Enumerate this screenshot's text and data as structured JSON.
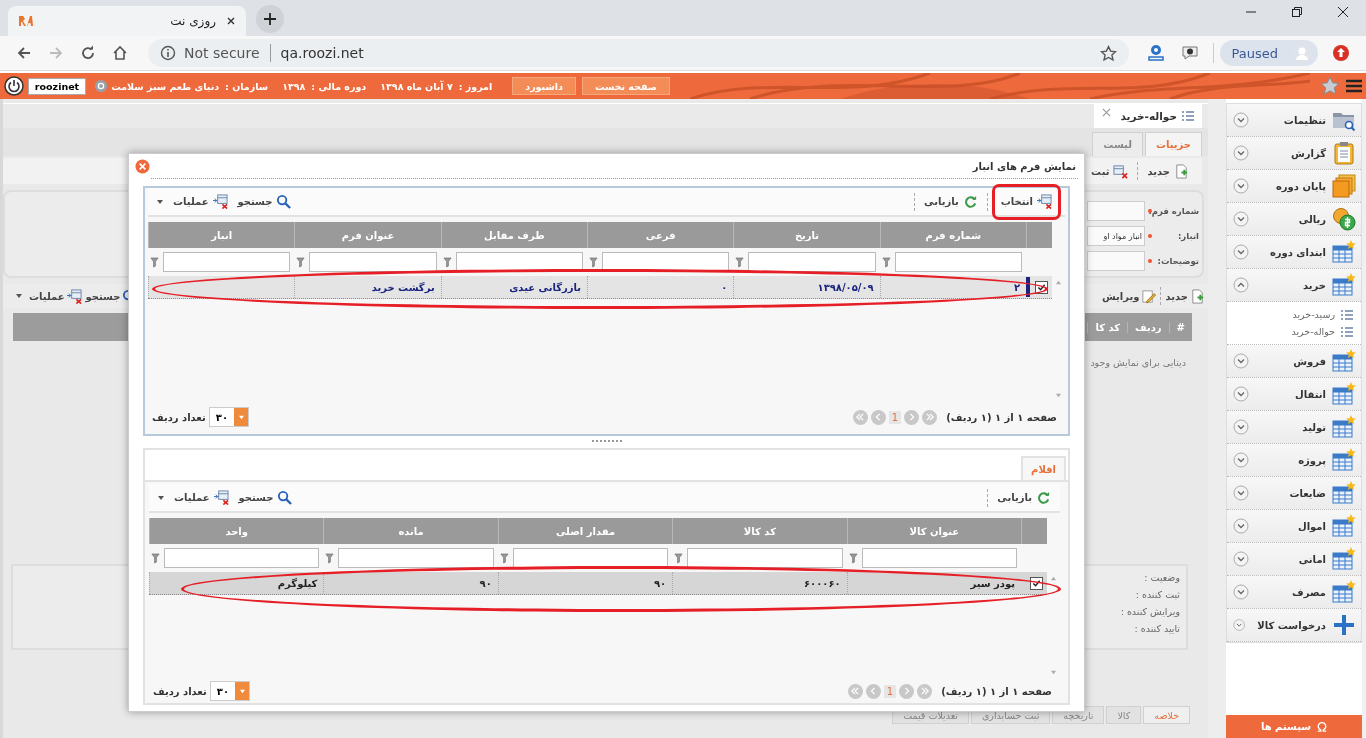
{
  "browser": {
    "tab_title": "روزی نت",
    "security_label": "Not secure",
    "url": "qa.roozi.net",
    "profile_status": "Paused"
  },
  "header": {
    "user": "roozinet",
    "buttons": [
      "صفحه نخست",
      "داشبورد"
    ],
    "fields": [
      {
        "label": "امروز :",
        "value": "۷ آبان ماه ۱۳۹۸"
      },
      {
        "label": "دوره مالی :",
        "value": "۱۳۹۸"
      },
      {
        "label": "سازمان :",
        "value": "دنیای طعم سبز سلامت"
      }
    ]
  },
  "document_tab": {
    "title": "حواله-خرید"
  },
  "detail_tabs": [
    {
      "label": "جزییات",
      "selected": true
    },
    {
      "label": "لیست",
      "selected": false
    }
  ],
  "form_toolbar": [
    {
      "label": "جدید",
      "kind": "new"
    },
    {
      "label": "ثبت",
      "kind": "save"
    }
  ],
  "form": [
    {
      "label": "شماره فرم:",
      "required": true
    },
    {
      "label": "انبار:",
      "required": true,
      "value": "انبار مواد او"
    },
    {
      "label": "توضیحات:",
      "required": true
    }
  ],
  "items_toolbar": {
    "right": [
      {
        "label": "جدید",
        "kind": "new"
      },
      {
        "label": "ویرایش",
        "kind": "edit"
      }
    ],
    "left": [
      {
        "label": "جستجو",
        "kind": "search"
      },
      {
        "label": "عملیات",
        "kind": "ops"
      }
    ]
  },
  "items_grid": {
    "columns": [
      "#",
      "ردیف",
      "کد کا"
    ],
    "empty_text": "دیتایی برای نمایش وجود"
  },
  "status_labels": [
    "وضعیت :",
    "ثبت کننده :",
    "ویرایش کننده :",
    "تایید کننده :"
  ],
  "bottom_tabs": [
    {
      "label": "خلاصه",
      "selected": true
    },
    {
      "label": "کالا",
      "selected": false
    },
    {
      "label": "تاریخچه",
      "selected": false
    },
    {
      "label": "ثبت حسابداری",
      "selected": false
    },
    {
      "label": "تعدیلات قیمت",
      "selected": false
    }
  ],
  "sidebar": {
    "items": [
      {
        "label": "تنظیمات",
        "kind": "folder",
        "expanded": false
      },
      {
        "label": "گزارش",
        "kind": "clipboard",
        "expanded": false
      },
      {
        "label": "پایان دوره",
        "kind": "stack",
        "expanded": false
      },
      {
        "label": "ریالی",
        "kind": "coins",
        "expanded": false
      },
      {
        "label": "ابتدای دوره",
        "kind": "table",
        "expanded": false
      },
      {
        "label": "خرید",
        "kind": "table",
        "expanded": true,
        "children": [
          {
            "label": "رسید-خرید"
          },
          {
            "label": "حواله-خرید"
          }
        ]
      },
      {
        "label": "فروش",
        "kind": "table",
        "expanded": false
      },
      {
        "label": "انتقال",
        "kind": "table",
        "expanded": false
      },
      {
        "label": "تولید",
        "kind": "table",
        "expanded": false
      },
      {
        "label": "پروژه",
        "kind": "table",
        "expanded": false
      },
      {
        "label": "ضایعات",
        "kind": "table",
        "expanded": false
      },
      {
        "label": "اموال",
        "kind": "table",
        "expanded": false
      },
      {
        "label": "امانی",
        "kind": "table",
        "expanded": false
      },
      {
        "label": "مصرف",
        "kind": "table",
        "expanded": false
      },
      {
        "label": "درخواست کالا",
        "kind": "plus",
        "expanded": false
      }
    ],
    "system_button": "سیستم ها"
  },
  "modal": {
    "title": "نمایش فرم های انبار",
    "toolbar": {
      "right": [
        {
          "label": "انتخاب",
          "kind": "select",
          "marked": true
        },
        {
          "label": "بازیابی",
          "kind": "refresh",
          "marked": false
        }
      ],
      "left": [
        {
          "label": "جستجو",
          "kind": "search"
        },
        {
          "label": "عملیات",
          "kind": "ops"
        }
      ]
    },
    "forms_grid": {
      "columns": [
        "شماره فرم",
        "تاریخ",
        "فرعی",
        "طرف مقابل",
        "عنوان فرم",
        "انبار"
      ],
      "rows": [
        {
          "checked": true,
          "selected": true,
          "cells": [
            "۲",
            "۱۳۹۸/۰۵/۰۹",
            "۰",
            "بازرگانی عیدی",
            "برگشت خرید"
          ]
        }
      ],
      "marked": true,
      "pager": "صفحه ۱ از ۱ (۱ ردیف)",
      "page": "1",
      "page_size_label": "تعداد ردیف",
      "page_size": "۳۰"
    },
    "detail_tabs": [
      {
        "label": "اقلام",
        "selected": true
      }
    ],
    "items_toolbar": {
      "right": [
        {
          "label": "بازیابی",
          "kind": "refresh",
          "marked": false
        }
      ],
      "left": [
        {
          "label": "جستجو",
          "kind": "search"
        },
        {
          "label": "عملیات",
          "kind": "ops"
        }
      ]
    },
    "items_grid": {
      "columns": [
        "عنوان کالا",
        "کد کالا",
        "مقدار اصلی",
        "مانده",
        "واحد"
      ],
      "rows": [
        {
          "checked": true,
          "selected": false,
          "cells": [
            "پودر سیر",
            "۶۰۰۰۶۰",
            "۹۰",
            "۹۰",
            "کیلوگرم"
          ]
        }
      ],
      "marked": true,
      "pager": "صفحه ۱ از ۱ (۱ ردیف)",
      "page": "1",
      "page_size_label": "تعداد ردیف",
      "page_size": "۳۰"
    }
  }
}
